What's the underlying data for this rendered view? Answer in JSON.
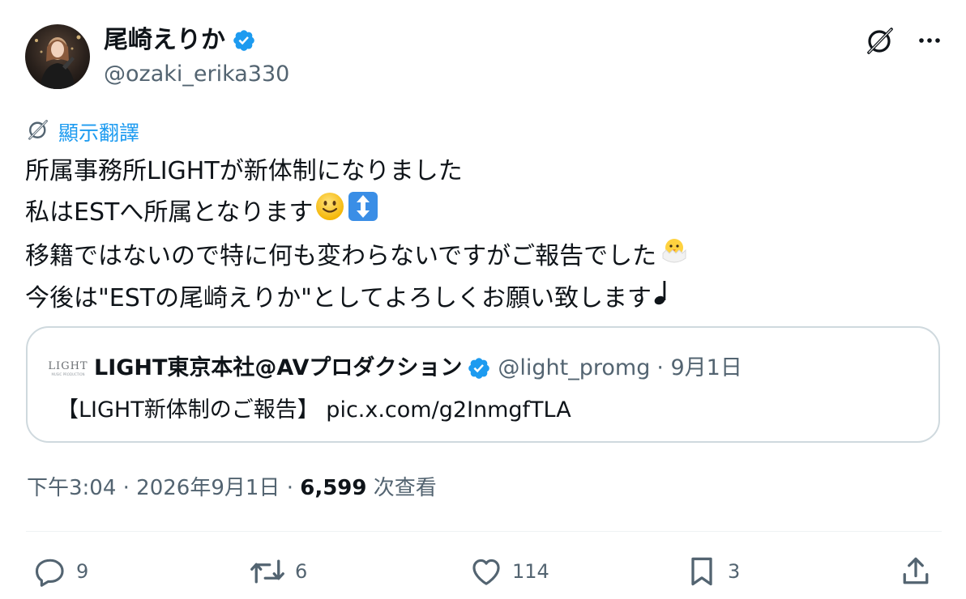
{
  "author": {
    "display_name": "尾崎えりか",
    "handle": "@ozaki_erika330",
    "verified": true
  },
  "icons": {
    "grok": "grok-icon",
    "more": "more-icon",
    "translate": "translate-icon",
    "verified": "verified-badge-icon"
  },
  "translate_label": "顯示翻譯",
  "tweet": {
    "lines": [
      "所属事務所LIGHTが新体制になりました",
      "私はESTへ所属となります",
      "移籍ではないので特に何も変わらないですがご報告でした",
      "今後は\"ESTの尾崎えりか\"としてよろしくお願い致します"
    ],
    "emojis": [
      "slightly-smiling-face",
      "up-down-arrow",
      "hatching-chick",
      "musical-note"
    ]
  },
  "quote": {
    "avatar_logo": "LIGHT",
    "avatar_sub": "MUSIC PRODUCTION",
    "display_name": "LIGHT東京本社@AVプロダクション",
    "handle": "@light_promg",
    "date": "· 9月1日",
    "text": "【LIGHT新体制のご報告】 pic.x.com/g2InmgfTLA"
  },
  "meta": {
    "time_date": "下午3:04 · 2026年9月1日 · ",
    "views_count": "6,599",
    "views_label": " 次查看"
  },
  "actions": {
    "replies": "9",
    "retweets": "6",
    "likes": "114",
    "bookmarks": "3"
  },
  "colors": {
    "accent": "#1d9bf0",
    "text": "#0f1419",
    "secondary": "#536471",
    "border": "#cfd9de"
  }
}
